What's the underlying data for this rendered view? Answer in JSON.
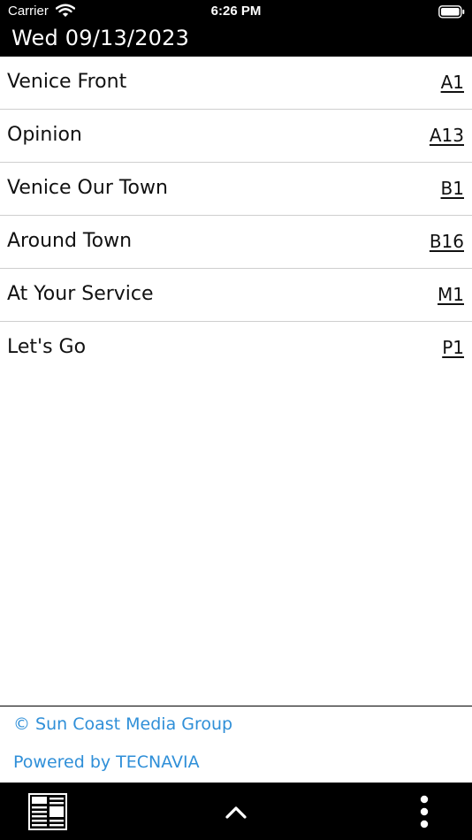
{
  "status_bar": {
    "carrier": "Carrier",
    "time": "6:26 PM"
  },
  "header": {
    "date": "Wed 09/13/2023"
  },
  "sections": [
    {
      "label": "Venice Front",
      "page": "A1"
    },
    {
      "label": "Opinion",
      "page": "A13"
    },
    {
      "label": "Venice Our Town",
      "page": "B1"
    },
    {
      "label": "Around Town",
      "page": "B16"
    },
    {
      "label": "At Your Service",
      "page": "M1"
    },
    {
      "label": "Let's Go",
      "page": "P1"
    }
  ],
  "footer": {
    "copyright": "© Sun Coast Media Group",
    "powered_by": "Powered by TECNAVIA"
  },
  "icons": {
    "news": "newspaper-icon",
    "up": "chevron-up-icon",
    "more": "more-vertical-icon"
  },
  "colors": {
    "bar_background": "#000000",
    "link_blue": "#2f8fd8"
  }
}
